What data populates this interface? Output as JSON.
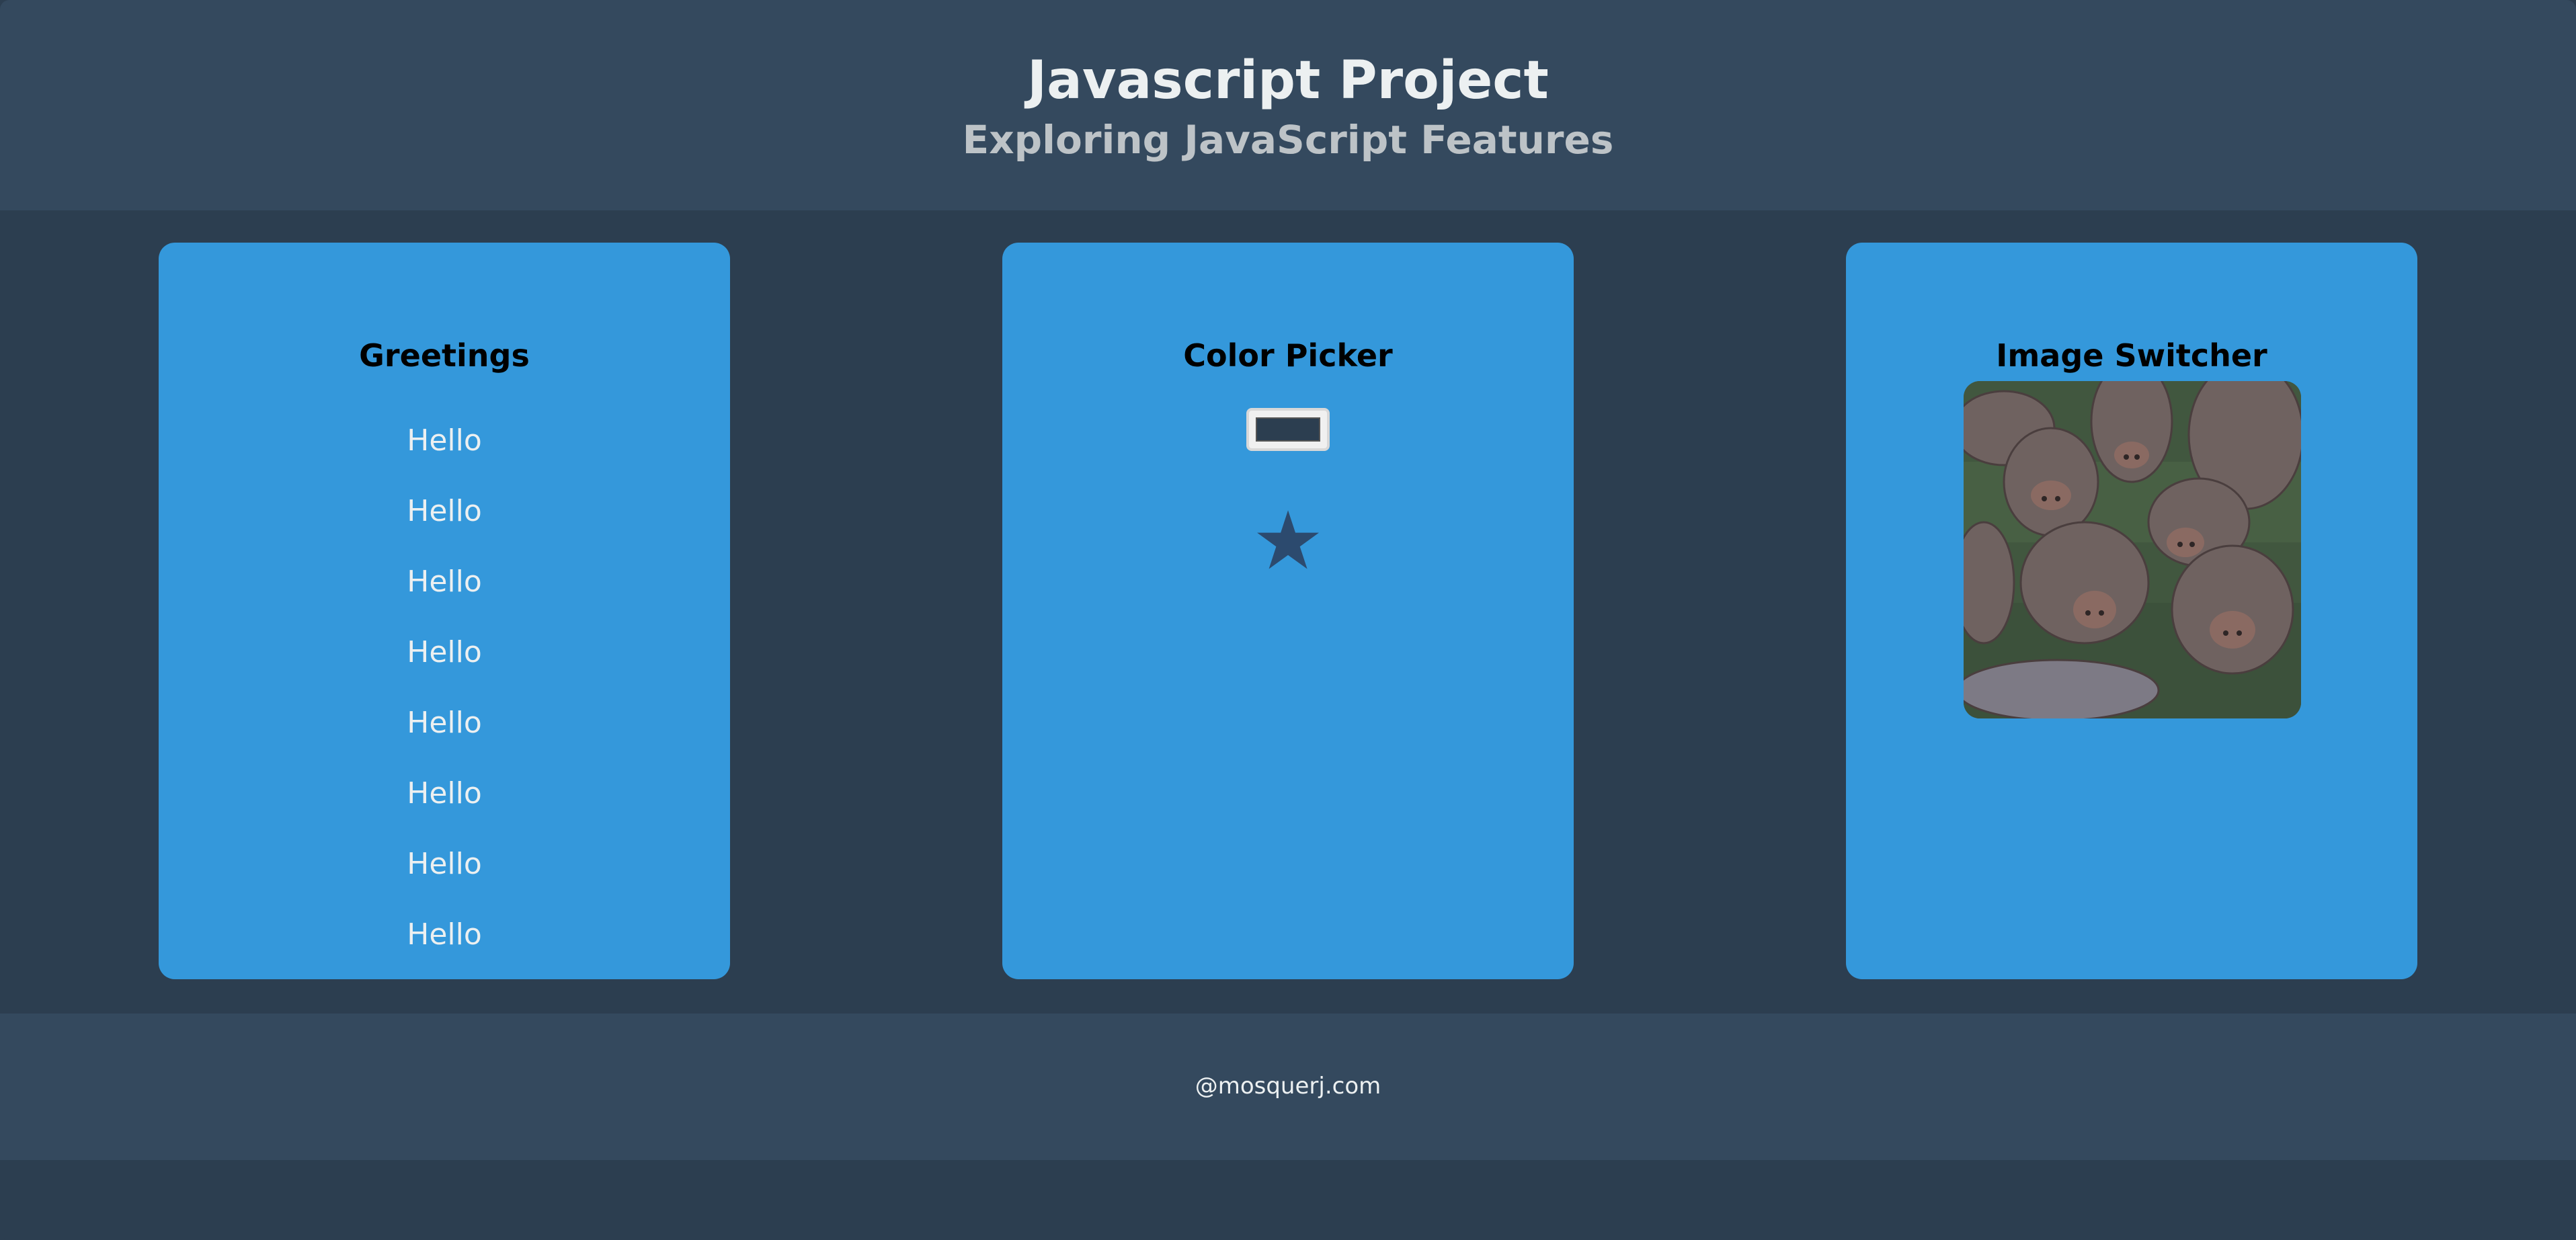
{
  "header": {
    "title": "Javascript Project",
    "subtitle": "Exploring JavaScript Features"
  },
  "greetings": {
    "heading": "Greetings",
    "items": [
      "Hello",
      "Hello",
      "Hello",
      "Hello",
      "Hello",
      "Hello",
      "Hello",
      "Hello"
    ]
  },
  "color_picker": {
    "heading": "Color Picker",
    "selected_color": "#2c3e50",
    "star_icon": "star-icon",
    "star_glyph": "★"
  },
  "image_switcher": {
    "heading": "Image Switcher",
    "image_subject": "hippopotamus-photo"
  },
  "footer": {
    "text": "@mosquerj.com"
  },
  "colors": {
    "background": "#2c3e50",
    "header_footer": "#34495e",
    "card": "#3498db",
    "text_light": "#ecf0f1",
    "subtitle": "#bdc3c7"
  }
}
